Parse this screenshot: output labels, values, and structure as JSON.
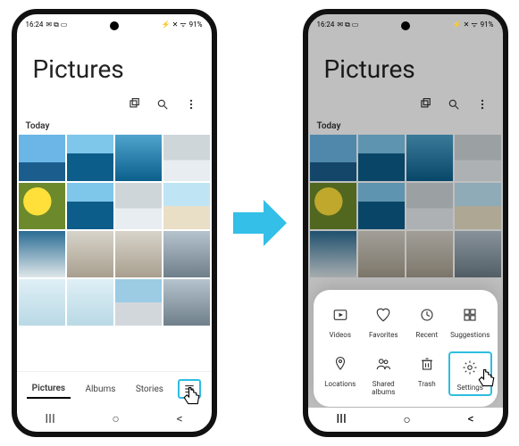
{
  "status": {
    "time": "16:24",
    "battery": "91%"
  },
  "header": {
    "title": "Pictures"
  },
  "section": {
    "today": "Today"
  },
  "tabs": {
    "pictures": "Pictures",
    "albums": "Albums",
    "stories": "Stories"
  },
  "sheet": {
    "videos": "Videos",
    "favorites": "Favorites",
    "recent": "Recent",
    "suggestions": "Suggestions",
    "locations": "Locations",
    "shared": "Shared albums",
    "trash": "Trash",
    "settings": "Settings"
  },
  "nav": {
    "recents": "|||",
    "home": "○",
    "back": "<"
  }
}
